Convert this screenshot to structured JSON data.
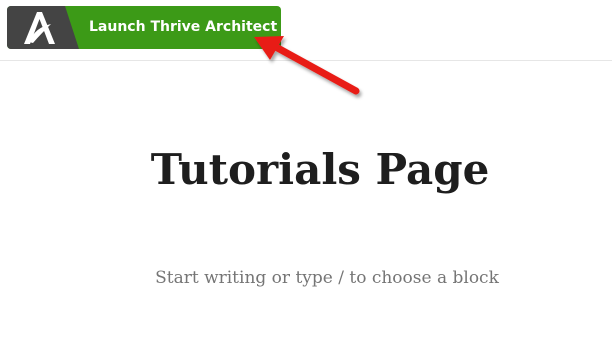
{
  "toolbar": {
    "launch_label": "Launch Thrive Architect",
    "logo_icon": "thrive-architect-logo-icon"
  },
  "editor": {
    "title": "Tutorials Page",
    "placeholder": "Start writing or type / to choose a block"
  },
  "annotation": {
    "arrow_icon": "red-arrow-icon"
  },
  "colors": {
    "button_green": "#3c9a17",
    "logo_dark": "#444444",
    "arrow_red": "#e81e16",
    "title_text": "#1e1e1e",
    "placeholder_text": "#757575"
  }
}
